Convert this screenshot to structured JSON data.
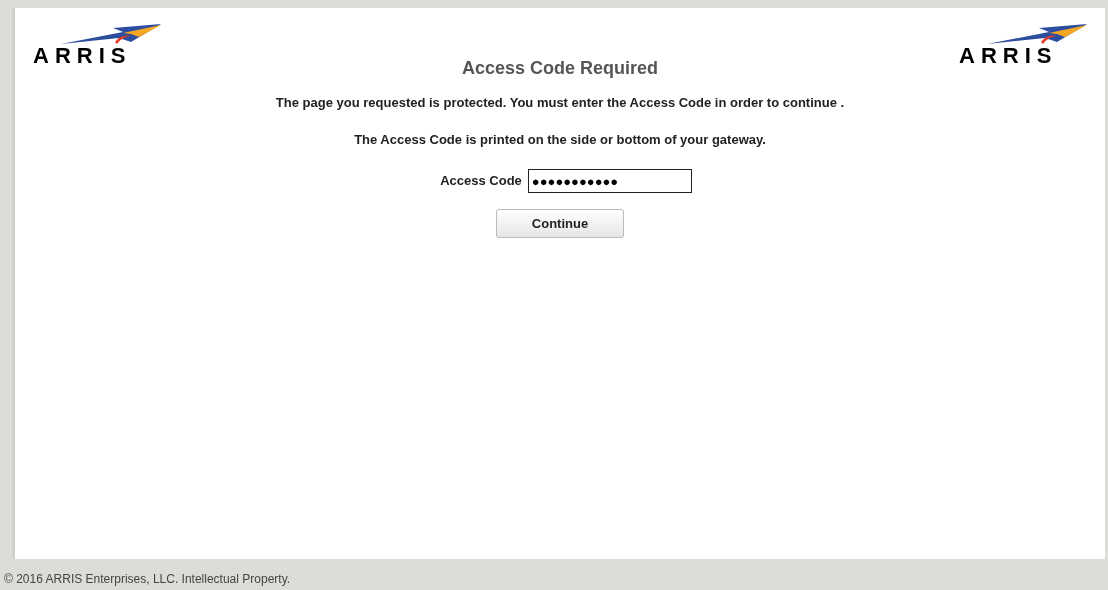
{
  "logos": [
    "ARRIS",
    "ARRIS"
  ],
  "title": "Access Code Required",
  "messages": [
    "The page you requested is protected. You must enter the Access Code in order to continue .",
    "The Access Code is printed on the side or bottom of your gateway."
  ],
  "field": {
    "label": "Access Code",
    "value": "●●●●●●●●●●●"
  },
  "button": "Continue",
  "footer": "© 2016 ARRIS Enterprises, LLC. Intellectual Property."
}
